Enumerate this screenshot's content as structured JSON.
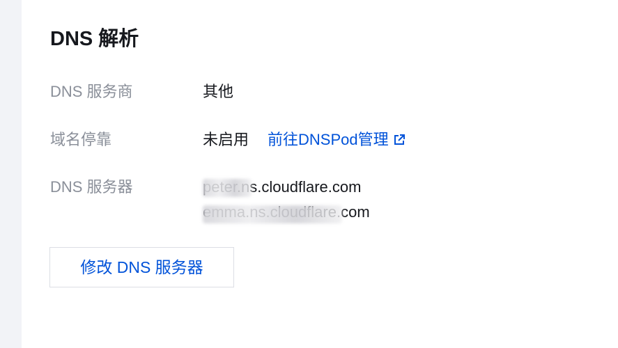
{
  "section": {
    "title": "DNS 解析"
  },
  "rows": {
    "provider": {
      "label": "DNS 服务商",
      "value": "其他"
    },
    "parking": {
      "label": "域名停靠",
      "value": "未启用",
      "link_label": "前往DNSPod管理",
      "link_icon": "external-link-icon"
    },
    "servers": {
      "label": "DNS 服务器",
      "values": [
        "peter.ns.cloudflare.com",
        "emma.ns.cloudflare.com"
      ]
    }
  },
  "actions": {
    "modify_dns_label": "修改 DNS 服务器"
  },
  "colors": {
    "link": "#0052d9",
    "label": "#8a8f99",
    "text": "#16181d",
    "rail": "#f2f3f7"
  }
}
